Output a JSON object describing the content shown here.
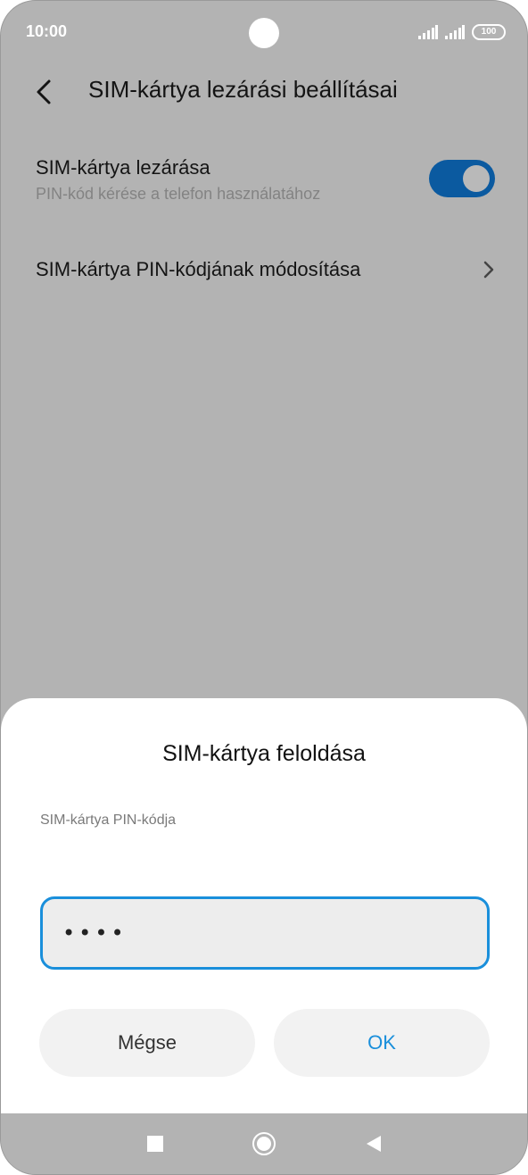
{
  "status_bar": {
    "time": "10:00",
    "battery": "100",
    "icons": [
      "signal-icon",
      "signal-icon",
      "battery-icon"
    ],
    "icon_color": "#ffffff"
  },
  "header": {
    "title": "SIM-kártya lezárási beállításai",
    "back_icon": "chevron-left-icon"
  },
  "settings": {
    "lock": {
      "title": "SIM-kártya lezárása",
      "subtitle": "PIN-kód kérése a telefon használatához",
      "toggle_on": true,
      "toggle_color": "#0b5aa0"
    },
    "change_pin": {
      "title": "SIM-kártya PIN-kódjának módosítása",
      "icon": "chevron-right-icon"
    }
  },
  "dialog": {
    "title": "SIM-kártya feloldása",
    "field_label": "SIM-kártya PIN-kódja",
    "pin_value": "••••",
    "cancel_label": "Mégse",
    "ok_label": "OK",
    "accent_color": "#1a8fdb"
  },
  "nav_bar": {
    "icons": [
      "recent-apps-icon",
      "home-icon",
      "back-triangle-icon"
    ]
  },
  "colors": {
    "scrim": "#b3b3b3",
    "dialog_background": "#ffffff"
  }
}
